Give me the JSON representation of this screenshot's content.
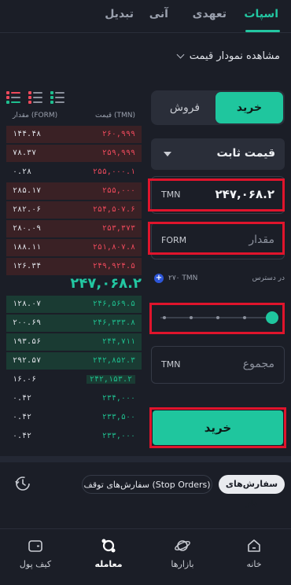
{
  "tabs": [
    {
      "label": "اسپات"
    },
    {
      "label": "تعهدی"
    },
    {
      "label": "آنی"
    },
    {
      "label": "تبدیل"
    }
  ],
  "chart_toggle_label": "مشاهده نمودار قیمت",
  "book": {
    "header_amount": "مقدار (FORM)",
    "header_price": "قیمت (TMN)",
    "asks": [
      {
        "amount": "۱۴۴.۴۸",
        "price": "۲۶۰,۹۹۹"
      },
      {
        "amount": "۷۸.۳۷",
        "price": "۲۵۹,۹۹۹"
      },
      {
        "amount": "۰.۲۸",
        "price": "۲۵۵,۰۰۰.۱"
      },
      {
        "amount": "۲۸۵.۱۷",
        "price": "۲۵۵,۰۰۰"
      },
      {
        "amount": "۲۸۲.۰۶",
        "price": "۲۵۴,۵۰۷.۶"
      },
      {
        "amount": "۲۸۰.۰۹",
        "price": "۲۵۳,۳۷۳"
      },
      {
        "amount": "۱۸۸.۱۱",
        "price": "۲۵۱,۸۰۷.۸"
      },
      {
        "amount": "۱۲۶.۳۴",
        "price": "۲۴۹,۹۲۴.۵"
      }
    ],
    "last_price": "۲۴۷,۰۶۸.۲",
    "bids": [
      {
        "amount": "۱۲۸.۰۷",
        "price": "۲۴۶,۵۶۹.۵"
      },
      {
        "amount": "۲۰۰.۶۹",
        "price": "۲۴۶,۳۳۳.۸"
      },
      {
        "amount": "۱۹۳.۵۶",
        "price": "۲۴۴,۷۱۱"
      },
      {
        "amount": "۲۹۲.۵۷",
        "price": "۲۴۲,۸۵۲.۳"
      },
      {
        "amount": "۱۶.۰۶",
        "price": "۲۴۲,۱۵۳.۲"
      },
      {
        "amount": "۰.۴۲",
        "price": "۲۳۴,۰۰۰"
      },
      {
        "amount": "۰.۴۲",
        "price": "۲۳۳,۵۰۰"
      },
      {
        "amount": "۰.۴۲",
        "price": "۲۳۳,۰۰۰"
      }
    ]
  },
  "form": {
    "buy_label": "خرید",
    "sell_label": "فروش",
    "order_type": "قیمت ثابت",
    "price_value": "۲۴۷,۰۶۸.۲",
    "price_unit": "TMN",
    "amount_placeholder": "مقدار",
    "amount_unit": "FORM",
    "available_label": "در دسترس",
    "available_balance": "۲۷۰ TMN",
    "slider_percent": 100,
    "total_placeholder": "مجموع",
    "total_unit": "TMN",
    "submit_label": "خرید"
  },
  "orders": {
    "open_label": "سفارش‌های باز",
    "stop_label": "سفارش‌های توقف (Stop Orders)"
  },
  "nav": [
    {
      "label": "خانه",
      "icon": "home-icon"
    },
    {
      "label": "بازارها",
      "icon": "planet-icon"
    },
    {
      "label": "معامله",
      "icon": "trade-icon"
    },
    {
      "label": "کیف پول",
      "icon": "wallet-icon"
    }
  ],
  "colors": {
    "accent": "#1fc69e",
    "ask": "#ee4a5c",
    "bid": "#1fbf8f",
    "highlight": "#e0142c"
  }
}
